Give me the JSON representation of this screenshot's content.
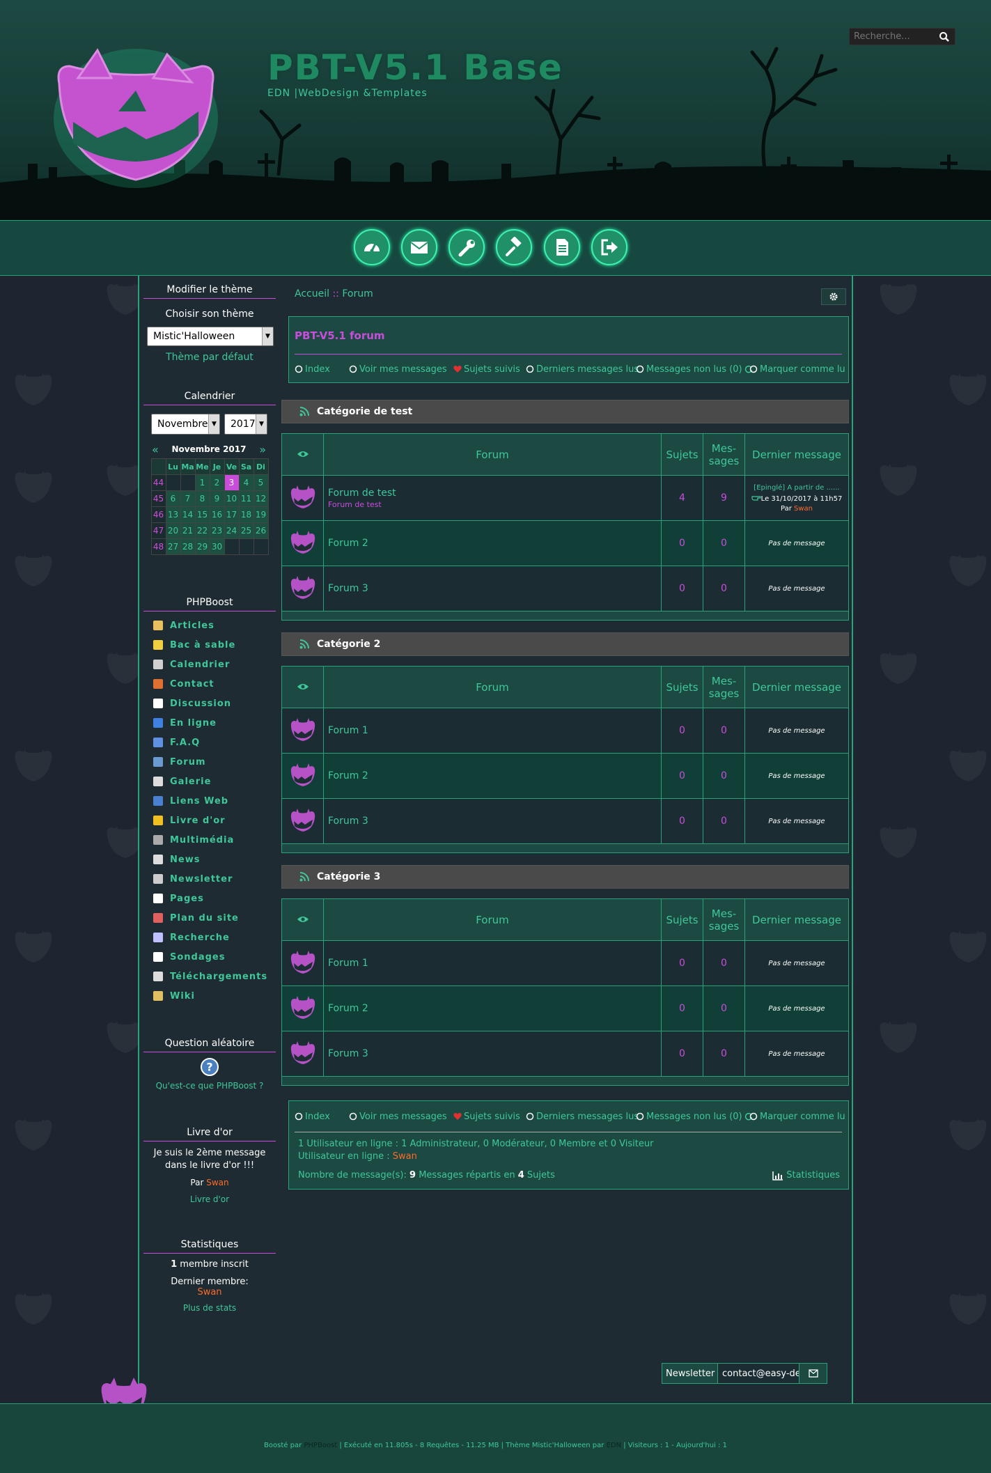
{
  "header": {
    "title": "PBT-V5.1 Base",
    "subtitle": "EDN |WebDesign &Templates",
    "search_placeholder": "Recherche..."
  },
  "nav_icons": [
    "dashboard-icon",
    "envelope-icon",
    "wrench-icon",
    "gavel-icon",
    "document-icon",
    "sign-out-icon"
  ],
  "sidebar": {
    "theme": {
      "title": "Modifier le thème",
      "choose_label": "Choisir son thème",
      "selected": "Mistic'Halloween",
      "default_link": "Thème par défaut"
    },
    "calendar": {
      "title": "Calendrier",
      "month_select": "Novembre",
      "year_select": "2017",
      "month_label": "Novembre 2017",
      "headers": [
        "Lu",
        "Ma",
        "Me",
        "Je",
        "Ve",
        "Sa",
        "Di"
      ],
      "weeks": [
        {
          "num": "44",
          "days": [
            "",
            "",
            "1",
            "2",
            "3",
            "4",
            "5"
          ]
        },
        {
          "num": "45",
          "days": [
            "6",
            "7",
            "8",
            "9",
            "10",
            "11",
            "12"
          ]
        },
        {
          "num": "46",
          "days": [
            "13",
            "14",
            "15",
            "16",
            "17",
            "18",
            "19"
          ]
        },
        {
          "num": "47",
          "days": [
            "20",
            "21",
            "22",
            "23",
            "24",
            "25",
            "26"
          ]
        },
        {
          "num": "48",
          "days": [
            "27",
            "28",
            "29",
            "30",
            "",
            "",
            ""
          ]
        }
      ],
      "today": "3"
    },
    "phpboost": {
      "title": "PHPBoost",
      "items": [
        "Articles",
        "Bac à sable",
        "Calendrier",
        "Contact",
        "Discussion",
        "En ligne",
        "F.A.Q",
        "Forum",
        "Galerie",
        "Liens Web",
        "Livre d'or",
        "Multimédia",
        "News",
        "Newsletter",
        "Pages",
        "Plan du site",
        "Recherche",
        "Sondages",
        "Téléchargements",
        "Wiki"
      ]
    },
    "question": {
      "title": "Question aléatoire",
      "link": "Qu'est-ce que PHPBoost ?"
    },
    "guestbook": {
      "title": "Livre d'or",
      "message": "Je suis le 2ème message dans le livre d'or !!!",
      "by_label": "Par",
      "author": "Swan",
      "link": "Livre d'or"
    },
    "stats": {
      "title": "Statistiques",
      "members_count": "1",
      "members_label": "membre inscrit",
      "last_member_label": "Dernier membre:",
      "last_member": "Swan",
      "more_link": "Plus de stats"
    }
  },
  "main": {
    "breadcrumb": {
      "home": "Accueil",
      "sep": "::",
      "current": "Forum"
    },
    "forum_title": "PBT-V5.1 forum",
    "links": {
      "index": "Index",
      "my_messages": "Voir mes messages",
      "followed": "Sujets suivis",
      "last_messages": "Derniers messages lus",
      "unread": "Messages non lus (0)",
      "mark_read": "Marquer comme lu"
    },
    "table_headers": {
      "forum": "Forum",
      "topics": "Sujets",
      "messages": "Mes-sages",
      "last": "Dernier message"
    },
    "categories": [
      {
        "name": "Catégorie de test",
        "forums": [
          {
            "name": "Forum de test",
            "desc": "Forum de test",
            "topics": "4",
            "messages": "9",
            "last_title": "[Epinglé] A partir de ......",
            "last_date": "Le 31/10/2017 à 11h57",
            "last_by": "Par",
            "last_user": "Swan"
          },
          {
            "name": "Forum 2",
            "topics": "0",
            "messages": "0",
            "last": "Pas de message"
          },
          {
            "name": "Forum 3",
            "topics": "0",
            "messages": "0",
            "last": "Pas de message"
          }
        ]
      },
      {
        "name": "Catégorie 2",
        "forums": [
          {
            "name": "Forum 1",
            "topics": "0",
            "messages": "0",
            "last": "Pas de message"
          },
          {
            "name": "Forum 2",
            "topics": "0",
            "messages": "0",
            "last": "Pas de message"
          },
          {
            "name": "Forum 3",
            "topics": "0",
            "messages": "0",
            "last": "Pas de message"
          }
        ]
      },
      {
        "name": "Catégorie 3",
        "forums": [
          {
            "name": "Forum 1",
            "topics": "0",
            "messages": "0",
            "last": "Pas de message"
          },
          {
            "name": "Forum 2",
            "topics": "0",
            "messages": "0",
            "last": "Pas de message"
          },
          {
            "name": "Forum 3",
            "topics": "0",
            "messages": "0",
            "last": "Pas de message"
          }
        ]
      }
    ],
    "online": {
      "line1": "1 Utilisateur en ligne : 1 Administrateur, 0 Modérateur, 0 Membre et 0 Visiteur",
      "line2_label": "Utilisateur en ligne :",
      "line2_user": "Swan",
      "stats_prefix": "Nombre de message(s):",
      "stats_messages": "9",
      "stats_mid": "Messages répartis en",
      "stats_topics": "4",
      "stats_suffix": "Sujets",
      "stats_link": "Statistiques"
    }
  },
  "newsletter": {
    "label": "Newsletter",
    "value": "contact@easy-de"
  },
  "footer": {
    "powered": "Boosté par",
    "powered_link": "PHPBoost",
    "exec": "| Exécuté en 11.805s - 8 Requêtes - 11.25 MB | Thème Mistic'Halloween par",
    "theme_author": "EDN",
    "visitors": "| Visiteurs : 1 - Aujourd'hui : 1"
  },
  "colors": {
    "accent": "#3fc79a",
    "magenta": "#c94ddb",
    "orange": "#ff6a2a",
    "dark_bg": "#1f2530"
  }
}
